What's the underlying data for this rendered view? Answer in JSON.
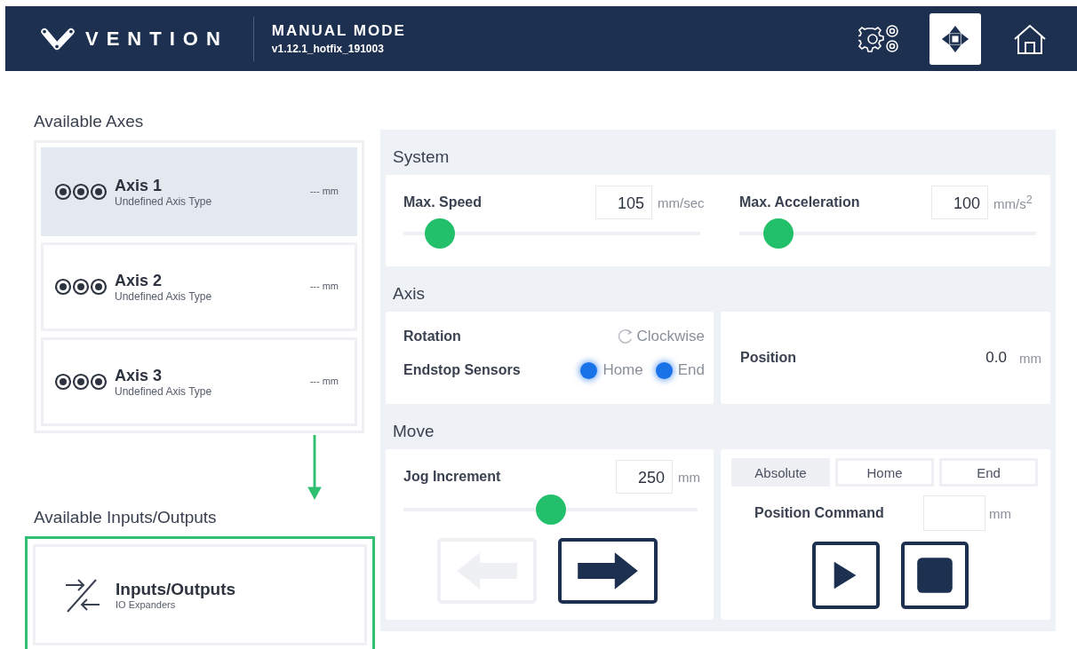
{
  "header": {
    "logo": "VENTION",
    "title": "MANUAL MODE",
    "version": "v1.12.1_hotfix_191003",
    "nav": [
      {
        "kind": "settings",
        "selected": false
      },
      {
        "kind": "jog",
        "selected": true
      },
      {
        "kind": "home",
        "selected": false
      }
    ]
  },
  "axes": {
    "title": "Available Axes",
    "items": [
      {
        "name": "Axis 1",
        "type": "Undefined Axis Type",
        "reading": "--- mm",
        "selected": true
      },
      {
        "name": "Axis 2",
        "type": "Undefined Axis Type",
        "reading": "--- mm",
        "selected": false
      },
      {
        "name": "Axis 3",
        "type": "Undefined Axis Type",
        "reading": "--- mm",
        "selected": false
      }
    ]
  },
  "io": {
    "title": "Available Inputs/Outputs",
    "item": {
      "name": "Inputs/Outputs",
      "subtitle": "IO Expanders",
      "highlighted": true
    }
  },
  "system": {
    "title": "System",
    "fields": [
      {
        "label": "Max. Speed",
        "value": "105",
        "unit": "mm/sec",
        "level": 0.08
      },
      {
        "label": "Max. Acceleration",
        "value": "100",
        "unit": "mm/s$^{2}$",
        "level": 0.09
      }
    ]
  },
  "axis": {
    "title": "Axis",
    "rotation": {
      "label": "Rotation",
      "value": "Clockwise"
    },
    "endstop": {
      "label": "Endstop Sensors",
      "sensors": [
        {
          "label": "Home",
          "on": true
        },
        {
          "label": "End",
          "on": true
        }
      ]
    },
    "position": {
      "label": "Position",
      "value": "0.0",
      "unit": "mm"
    }
  },
  "move": {
    "title": "Move",
    "jog": {
      "label": "Jog Increment",
      "value": "250",
      "unit": "mm",
      "level": 0.5,
      "buttons": [
        {
          "kind": "left",
          "disabled": true
        },
        {
          "kind": "right",
          "disabled": false
        }
      ]
    },
    "modes": [
      {
        "label": "Absolute",
        "selected": true
      },
      {
        "label": "Home",
        "selected": false
      },
      {
        "label": "End",
        "selected": false
      }
    ],
    "command": {
      "label": "Position Command",
      "unit": "mm"
    },
    "actions": [
      {
        "kind": "play"
      },
      {
        "kind": "stop"
      }
    ]
  }
}
